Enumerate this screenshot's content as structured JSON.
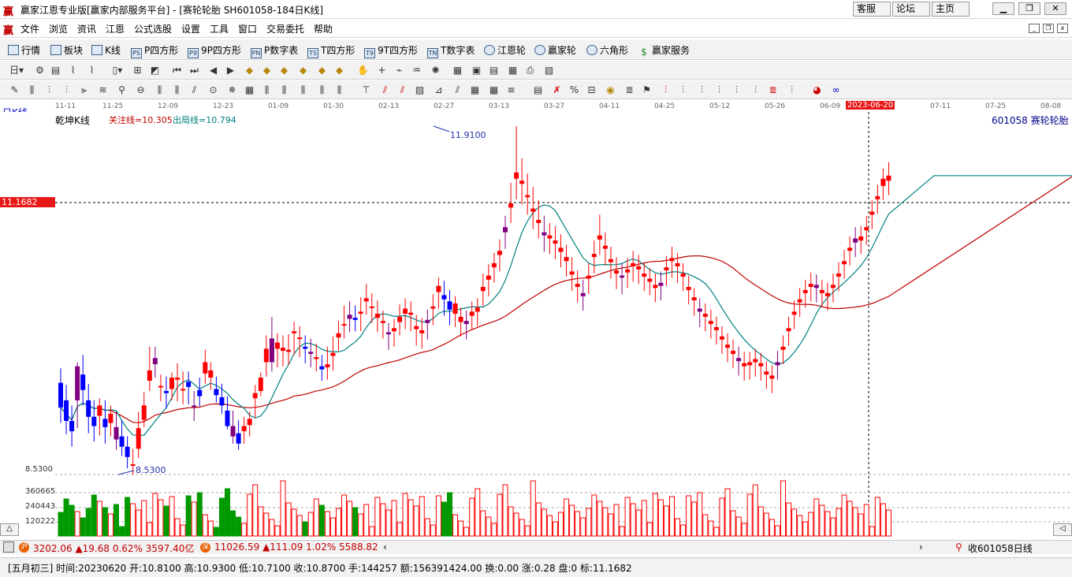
{
  "window": {
    "title": "赢家江恩专业版[赢家内部服务平台] - [赛轮轮胎  SH601058-184日K线]",
    "logo": "赢",
    "buttons": [
      "客服",
      "论坛",
      "主页"
    ]
  },
  "menu": {
    "logo": "赢",
    "items": [
      "文件",
      "浏览",
      "资讯",
      "江恩",
      "公式选股",
      "设置",
      "工具",
      "窗口",
      "交易委托",
      "帮助"
    ]
  },
  "toolbar1": {
    "items": [
      "行情",
      "板块",
      "K线",
      "P四方形",
      "9P四方形",
      "P数字表",
      "T四方形",
      "9T四方形",
      "T数字表",
      "江恩轮",
      "赢家轮",
      "六角形",
      "赢家服务"
    ],
    "icon_labels": [
      "",
      "",
      "",
      "PS",
      "P9",
      "PN",
      "TS",
      "T9",
      "TN",
      "",
      "",
      "",
      "$"
    ]
  },
  "date_axis": {
    "labels": [
      "11-11",
      "11-25",
      "12-09",
      "12-23",
      "01-09",
      "01-30",
      "02-13",
      "02-27",
      "03-13",
      "03-27",
      "04-11",
      "04-25",
      "05-12",
      "05-26",
      "06-09",
      "2023-06-20",
      "07-11",
      "07-25",
      "08-08"
    ],
    "selected": "2023-06-20"
  },
  "chart_header": {
    "period": "日K线",
    "indicator": "乾坤K线",
    "focus": "关注线=10.305",
    "exit": "出局线=10.794",
    "stock": "601058  赛轮轮胎"
  },
  "price_marks": {
    "current": "11.1682",
    "high": "11.9100",
    "low": "8.5300",
    "low_axis": "8.5300"
  },
  "volume_axis": [
    "360665",
    "240443",
    "120222"
  ],
  "colors": {
    "up": "#ff0000",
    "down": "#0000ff",
    "neutral": "#800080",
    "ma_short": "#008080",
    "ma_long": "#c00000",
    "vol_up": "#ff0000",
    "vol_down": "#009900"
  },
  "chart_data": {
    "type": "candlestick",
    "ylim": [
      8.53,
      11.91
    ],
    "ohlc": [
      [
        9.42,
        9.56,
        9.03,
        9.18
      ],
      [
        9.25,
        9.4,
        8.92,
        9.05
      ],
      [
        9.05,
        9.2,
        8.8,
        8.95
      ],
      [
        9.25,
        9.62,
        8.98,
        9.58
      ],
      [
        9.5,
        9.69,
        9.2,
        9.35
      ],
      [
        9.25,
        9.41,
        8.93,
        9.09
      ],
      [
        9.09,
        9.25,
        8.85,
        9.0
      ],
      [
        9.1,
        9.27,
        8.91,
        9.2
      ],
      [
        9.07,
        9.25,
        8.83,
        8.99
      ],
      [
        9.03,
        9.2,
        8.9,
        9.12
      ],
      [
        8.99,
        9.14,
        8.77,
        8.87
      ],
      [
        8.9,
        9.06,
        8.71,
        8.8
      ],
      [
        8.8,
        8.9,
        8.59,
        8.7
      ],
      [
        8.63,
        8.78,
        8.53,
        8.63
      ],
      [
        8.78,
        9.14,
        8.69,
        8.98
      ],
      [
        9.06,
        9.33,
        8.99,
        9.2
      ],
      [
        9.44,
        9.77,
        9.34,
        9.54
      ],
      [
        9.6,
        9.77,
        9.47,
        9.66
      ],
      [
        9.39,
        9.5,
        9.24,
        9.39
      ],
      [
        9.34,
        9.48,
        9.17,
        9.32
      ],
      [
        9.36,
        9.52,
        9.25,
        9.47
      ],
      [
        9.45,
        9.61,
        9.24,
        9.47
      ],
      [
        9.36,
        9.53,
        9.21,
        9.36
      ],
      [
        9.43,
        9.53,
        9.21,
        9.38
      ],
      [
        9.19,
        9.34,
        9.05,
        9.2
      ],
      [
        9.35,
        9.47,
        9.19,
        9.29
      ],
      [
        9.51,
        9.74,
        9.41,
        9.62
      ],
      [
        9.47,
        9.62,
        9.35,
        9.54
      ],
      [
        9.36,
        9.48,
        9.23,
        9.3
      ],
      [
        9.28,
        9.41,
        9.12,
        9.2
      ],
      [
        9.15,
        9.29,
        8.97,
        9.0
      ],
      [
        9.0,
        9.15,
        8.83,
        8.9
      ],
      [
        8.93,
        9.06,
        8.77,
        8.83
      ],
      [
        8.95,
        9.09,
        8.83,
        9.0
      ],
      [
        9.01,
        9.14,
        8.9,
        9.07
      ],
      [
        9.27,
        9.4,
        9.08,
        9.32
      ],
      [
        9.34,
        9.52,
        9.29,
        9.47
      ],
      [
        9.62,
        9.88,
        9.48,
        9.75
      ],
      [
        9.62,
        10.06,
        9.53,
        9.85
      ],
      [
        9.75,
        9.9,
        9.57,
        9.81
      ],
      [
        9.73,
        9.88,
        9.58,
        9.76
      ],
      [
        9.72,
        9.89,
        9.59,
        9.74
      ],
      [
        9.9,
        10.01,
        9.69,
        9.92
      ],
      [
        9.85,
        9.97,
        9.67,
        9.86
      ],
      [
        9.77,
        9.88,
        9.61,
        9.75
      ],
      [
        9.7,
        9.85,
        9.57,
        9.72
      ],
      [
        9.65,
        9.8,
        9.53,
        9.67
      ],
      [
        9.58,
        9.69,
        9.44,
        9.55
      ],
      [
        9.57,
        9.77,
        9.45,
        9.6
      ],
      [
        9.68,
        9.87,
        9.54,
        9.71
      ],
      [
        9.86,
        10.02,
        9.73,
        9.9
      ],
      [
        9.99,
        10.17,
        9.85,
        9.99
      ],
      [
        10.04,
        10.21,
        9.91,
        10.08
      ],
      [
        10.05,
        10.17,
        9.92,
        10.03
      ],
      [
        10.09,
        10.25,
        9.92,
        10.11
      ],
      [
        10.21,
        10.38,
        10.08,
        10.24
      ],
      [
        10.15,
        10.29,
        10.0,
        10.16
      ],
      [
        10.05,
        10.22,
        9.91,
        10.09
      ],
      [
        10.0,
        10.12,
        9.85,
        10.02
      ],
      [
        9.89,
        10.0,
        9.74,
        9.91
      ],
      [
        9.92,
        10.04,
        9.77,
        9.95
      ],
      [
        10.01,
        10.18,
        9.88,
        10.06
      ],
      [
        10.09,
        10.24,
        9.94,
        10.14
      ],
      [
        10.08,
        10.21,
        9.92,
        10.1
      ],
      [
        9.94,
        10.08,
        9.78,
        9.97
      ],
      [
        9.9,
        10.05,
        9.75,
        9.93
      ],
      [
        10.0,
        10.13,
        9.84,
        10.03
      ],
      [
        10.14,
        10.28,
        9.98,
        10.16
      ],
      [
        10.3,
        10.44,
        10.14,
        10.36
      ],
      [
        10.27,
        10.41,
        10.07,
        10.23
      ],
      [
        10.21,
        10.32,
        9.98,
        10.13
      ],
      [
        10.09,
        10.26,
        9.96,
        10.19
      ],
      [
        10.01,
        10.15,
        9.87,
        10.06
      ],
      [
        9.99,
        10.12,
        9.84,
        10.02
      ],
      [
        10.07,
        10.21,
        9.93,
        10.11
      ],
      [
        10.11,
        10.24,
        9.97,
        10.15
      ],
      [
        10.31,
        10.48,
        10.16,
        10.35
      ],
      [
        10.42,
        10.57,
        10.26,
        10.46
      ],
      [
        10.54,
        10.68,
        10.39,
        10.58
      ],
      [
        10.66,
        10.81,
        10.5,
        10.7
      ],
      [
        10.88,
        11.04,
        10.72,
        10.93
      ],
      [
        11.12,
        11.36,
        10.97,
        11.16
      ],
      [
        11.4,
        11.91,
        11.2,
        11.46
      ],
      [
        11.35,
        11.6,
        11.15,
        11.38
      ],
      [
        11.22,
        11.45,
        11.05,
        11.24
      ],
      [
        11.08,
        11.32,
        10.91,
        11.11
      ],
      [
        10.97,
        11.19,
        10.82,
        11.0
      ],
      [
        10.85,
        11.04,
        10.69,
        10.88
      ],
      [
        10.82,
        10.97,
        10.67,
        10.85
      ],
      [
        10.77,
        10.94,
        10.62,
        10.8
      ],
      [
        10.69,
        10.86,
        10.54,
        10.73
      ],
      [
        10.6,
        10.76,
        10.45,
        10.64
      ],
      [
        10.47,
        10.64,
        10.31,
        10.5
      ],
      [
        10.35,
        10.51,
        10.2,
        10.38
      ],
      [
        10.26,
        10.42,
        10.12,
        10.29
      ],
      [
        10.43,
        10.58,
        10.28,
        10.46
      ],
      [
        10.64,
        10.8,
        10.48,
        10.67
      ],
      [
        10.81,
        11.05,
        10.66,
        10.85
      ],
      [
        10.72,
        10.88,
        10.56,
        10.75
      ],
      [
        10.59,
        10.74,
        10.43,
        10.62
      ],
      [
        10.48,
        10.64,
        10.33,
        10.51
      ],
      [
        10.44,
        10.58,
        10.28,
        10.46
      ],
      [
        10.49,
        10.63,
        10.34,
        10.52
      ],
      [
        10.55,
        10.7,
        10.4,
        10.58
      ],
      [
        10.52,
        10.66,
        10.38,
        10.55
      ],
      [
        10.45,
        10.58,
        10.31,
        10.48
      ],
      [
        10.4,
        10.53,
        10.27,
        10.43
      ],
      [
        10.34,
        10.48,
        10.2,
        10.37
      ],
      [
        10.36,
        10.5,
        10.22,
        10.39
      ],
      [
        10.51,
        10.65,
        10.36,
        10.54
      ],
      [
        10.6,
        10.74,
        10.44,
        10.63
      ],
      [
        10.55,
        10.68,
        10.39,
        10.58
      ],
      [
        10.45,
        10.58,
        10.31,
        10.48
      ],
      [
        10.32,
        10.46,
        10.18,
        10.35
      ],
      [
        10.22,
        10.34,
        10.07,
        10.25
      ],
      [
        10.11,
        10.24,
        9.96,
        10.14
      ],
      [
        10.06,
        10.19,
        9.92,
        10.09
      ],
      [
        9.99,
        10.13,
        9.85,
        10.02
      ],
      [
        9.93,
        10.06,
        9.79,
        9.96
      ],
      [
        9.84,
        9.97,
        9.7,
        9.87
      ],
      [
        9.76,
        9.9,
        9.62,
        9.79
      ],
      [
        9.7,
        9.84,
        9.56,
        9.73
      ],
      [
        9.63,
        9.77,
        9.49,
        9.66
      ],
      [
        9.58,
        9.72,
        9.44,
        9.61
      ],
      [
        9.59,
        9.72,
        9.45,
        9.62
      ],
      [
        9.62,
        9.75,
        9.48,
        9.65
      ],
      [
        9.58,
        9.71,
        9.44,
        9.61
      ],
      [
        9.5,
        9.63,
        9.36,
        9.53
      ],
      [
        9.46,
        9.59,
        9.32,
        9.49
      ],
      [
        9.59,
        9.73,
        9.45,
        9.62
      ],
      [
        9.74,
        9.88,
        9.6,
        9.77
      ],
      [
        9.92,
        10.06,
        9.78,
        9.95
      ],
      [
        10.08,
        10.22,
        9.94,
        10.11
      ],
      [
        10.2,
        10.34,
        10.06,
        10.23
      ],
      [
        10.29,
        10.42,
        10.15,
        10.32
      ],
      [
        10.35,
        10.49,
        10.21,
        10.38
      ],
      [
        10.34,
        10.47,
        10.2,
        10.37
      ],
      [
        10.29,
        10.42,
        10.15,
        10.32
      ],
      [
        10.26,
        10.39,
        10.12,
        10.29
      ],
      [
        10.34,
        10.48,
        10.2,
        10.37
      ],
      [
        10.45,
        10.59,
        10.31,
        10.48
      ],
      [
        10.57,
        10.71,
        10.43,
        10.6
      ],
      [
        10.7,
        10.84,
        10.56,
        10.73
      ],
      [
        10.78,
        10.93,
        10.64,
        10.82
      ],
      [
        10.8,
        10.94,
        10.67,
        10.84
      ],
      [
        10.9,
        11.04,
        10.76,
        10.93
      ],
      [
        11.05,
        11.19,
        10.91,
        11.08
      ],
      [
        11.2,
        11.34,
        11.06,
        11.23
      ],
      [
        11.33,
        11.5,
        11.19,
        11.4
      ],
      [
        11.38,
        11.56,
        11.24,
        11.43
      ]
    ],
    "ma_short": [],
    "ma_long": [],
    "volume": []
  },
  "status1": {
    "sh": "3202.06 ▲19.68 0.62% 3597.40亿",
    "sz": "11026.59 ▲111.09 1.02% 5588.82",
    "right": "收601058日线"
  },
  "status2": {
    "text": "[五月初三] 时间:20230620 开:10.8100 高:10.9300 低:10.7100 收:10.8700 手:144257 额:156391424.00 换:0.00 涨:0.28 盘:0 标:11.1682"
  }
}
